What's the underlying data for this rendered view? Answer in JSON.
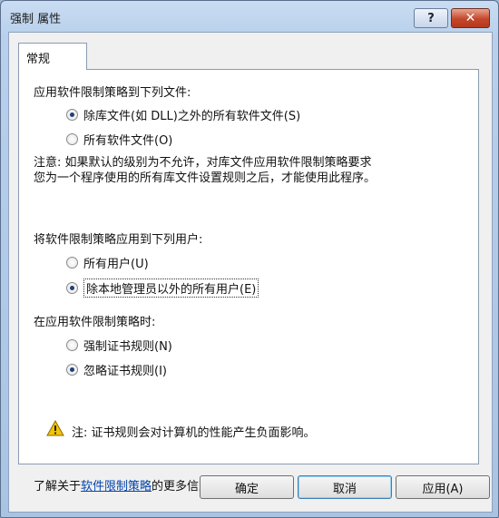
{
  "window": {
    "title": "强制 属性",
    "help_label": "?",
    "close_label": "✕"
  },
  "tabs": [
    {
      "label": "常规"
    }
  ],
  "section1": {
    "heading": "应用软件限制策略到下列文件:",
    "options": [
      {
        "label": "除库文件(如 DLL)之外的所有软件文件(S)",
        "checked": true
      },
      {
        "label": "所有软件文件(O)",
        "checked": false
      }
    ],
    "note_line1": "注意: 如果默认的级别为不允许，对库文件应用软件限制策略要求",
    "note_line2": "您为一个程序使用的所有库文件设置规则之后，才能使用此程序。"
  },
  "section2": {
    "heading": "将软件限制策略应用到下列用户:",
    "options": [
      {
        "label": "所有用户(U)",
        "checked": false
      },
      {
        "label": "除本地管理员以外的所有用户(E)",
        "checked": true
      }
    ]
  },
  "section3": {
    "heading": "在应用软件限制策略时:",
    "options": [
      {
        "label": "强制证书规则(N)",
        "checked": false
      },
      {
        "label": "忽略证书规则(I)",
        "checked": true
      }
    ],
    "warning": "注: 证书规则会对计算机的性能产生负面影响。"
  },
  "footer": {
    "prefix": "了解关于",
    "link": "软件限制策略",
    "suffix": "的更多信息"
  },
  "buttons": {
    "ok": "确定",
    "cancel": "取消",
    "apply": "应用(A)"
  }
}
